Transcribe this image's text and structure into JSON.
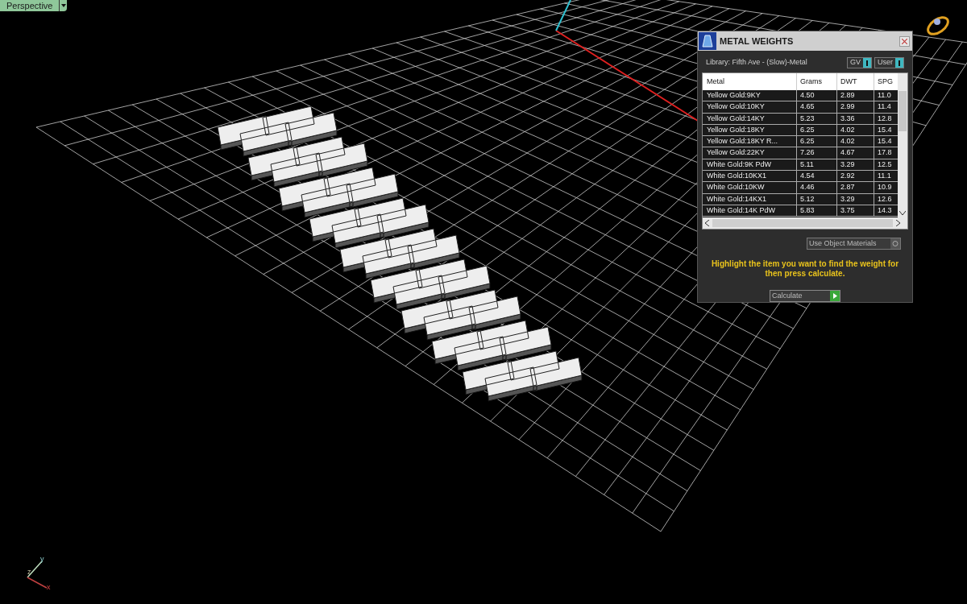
{
  "viewport": {
    "label": "Perspective"
  },
  "axes": {
    "y": "y",
    "z": "z",
    "x": "x"
  },
  "panel": {
    "title": "METAL WEIGHTS",
    "library": "Library: Fifth Ave - (Slow)-Metal",
    "toggles": [
      {
        "label": "GV"
      },
      {
        "label": "User"
      }
    ],
    "table": {
      "columns": [
        "Metal",
        "Grams",
        "DWT",
        "SPG"
      ],
      "rows": [
        [
          "Yellow Gold:9KY",
          "4.50",
          "2.89",
          "11.0"
        ],
        [
          "Yellow Gold:10KY",
          "4.65",
          "2.99",
          "11.4"
        ],
        [
          "Yellow Gold:14KY",
          "5.23",
          "3.36",
          "12.8"
        ],
        [
          "Yellow Gold:18KY",
          "6.25",
          "4.02",
          "15.4"
        ],
        [
          "Yellow Gold:18KY R...",
          "6.25",
          "4.02",
          "15.4"
        ],
        [
          "Yellow Gold:22KY",
          "7.26",
          "4.67",
          "17.8"
        ],
        [
          "White Gold:9K PdW",
          "5.11",
          "3.29",
          "12.5"
        ],
        [
          "White Gold:10KX1",
          "4.54",
          "2.92",
          "11.1"
        ],
        [
          "White Gold:10KW",
          "4.46",
          "2.87",
          "10.9"
        ],
        [
          "White Gold:14KX1",
          "5.12",
          "3.29",
          "12.6"
        ],
        [
          "White Gold:14K PdW",
          "5.83",
          "3.75",
          "14.3"
        ]
      ]
    },
    "material_dropdown": "Use Object Materials",
    "hint": "Highlight the item you want to find the weight for then press calculate.",
    "calculate_button": "Calculate"
  }
}
